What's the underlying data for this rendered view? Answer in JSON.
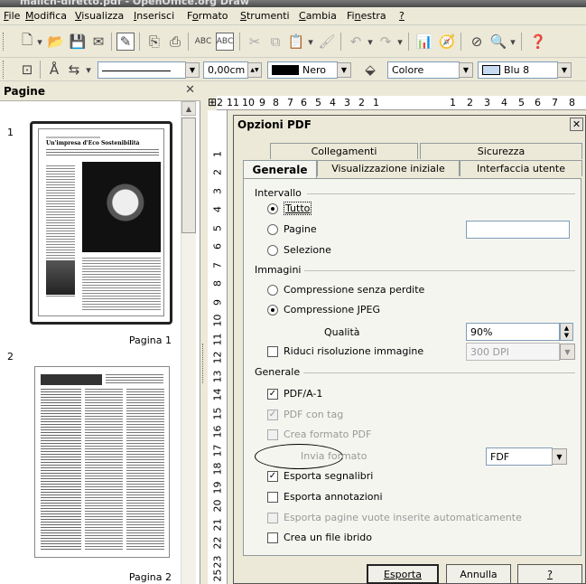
{
  "window": {
    "title": "malicn-diretto.pdf - OpenOffice.org Draw"
  },
  "menubar": {
    "items": [
      "File",
      "Modifica",
      "Visualizza",
      "Inserisci",
      "Formato",
      "Strumenti",
      "Cambia",
      "Finestra",
      "?"
    ]
  },
  "toolbar2": {
    "line_width": "0,00cm",
    "line_color": "Nero",
    "line_color_hex": "#000000",
    "area_style": "Colore",
    "area_color": "Blu 8",
    "area_color_hex": "#c6dbef"
  },
  "pages_panel": {
    "title": "Pagine",
    "pages": [
      {
        "number": "1",
        "caption": "Pagina 1",
        "headline": "Un'impresa d'Eco Sostenibilità"
      },
      {
        "number": "2",
        "caption": "Pagina 2"
      }
    ]
  },
  "ruler": {
    "h_left": [
      "2",
      "11",
      "10",
      "9",
      "8",
      "7",
      "6",
      "5",
      "4",
      "3",
      "2",
      "1"
    ],
    "h_right": [
      "1",
      "2",
      "3",
      "4",
      "5",
      "6",
      "7",
      "8"
    ],
    "v": [
      "1",
      "2",
      "3",
      "4",
      "5",
      "6",
      "7",
      "8",
      "9",
      "10",
      "11",
      "12",
      "13",
      "14",
      "15",
      "16",
      "17",
      "18",
      "19",
      "20",
      "21",
      "22",
      "23",
      "24",
      "25"
    ]
  },
  "dialog": {
    "title": "Opzioni PDF",
    "tabs_row1": [
      "Collegamenti",
      "Sicurezza"
    ],
    "tabs_row2": [
      "Generale",
      "Visualizzazione iniziale",
      "Interfaccia utente"
    ],
    "active_tab": "Generale",
    "range": {
      "label": "Intervallo",
      "all": "Tutto",
      "pages": "Pagine",
      "selection": "Selezione",
      "pages_value": ""
    },
    "images": {
      "label": "Immagini",
      "lossless": "Compressione senza perdite",
      "jpeg": "Compressione JPEG",
      "quality_label": "Qualità",
      "quality_value": "90%",
      "reduce": "Riduci risoluzione immagine",
      "dpi": "300 DPI"
    },
    "general": {
      "label": "Generale",
      "pdfa": "PDF/A-1",
      "tagged": "PDF con tag",
      "form": "Crea formato PDF",
      "submit_label": "Invia formato",
      "submit_value": "FDF",
      "bookmarks": "Esporta segnalibri",
      "notes": "Esporta annotazioni",
      "empty_pages": "Esporta pagine vuote inserite automaticamente",
      "hybrid": "Crea un file ibrido"
    },
    "buttons": {
      "export": "Esporta",
      "cancel": "Annulla",
      "help": "?"
    }
  }
}
